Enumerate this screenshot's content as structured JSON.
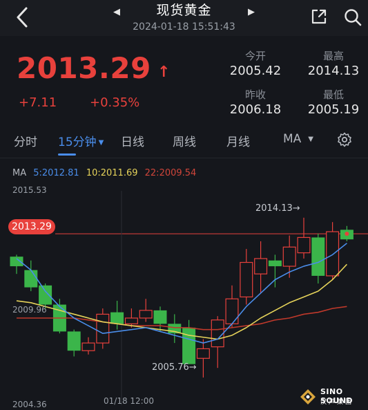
{
  "header": {
    "title": "现货黄金",
    "timestamp": "2024-01-18 15:51:43"
  },
  "quote": {
    "last": "2013.29",
    "change": "+7.11",
    "change_pct": "+0.35%",
    "stats": [
      {
        "label": "今开",
        "value": "2005.42"
      },
      {
        "label": "最高",
        "value": "2014.13"
      },
      {
        "label": "昨收",
        "value": "2006.18"
      },
      {
        "label": "最低",
        "value": "2005.19"
      }
    ]
  },
  "tabs": [
    {
      "label": "分时"
    },
    {
      "label": "15分钟"
    },
    {
      "label": "日线"
    },
    {
      "label": "周线"
    },
    {
      "label": "月线"
    },
    {
      "label": "MA"
    }
  ],
  "ma_legend": {
    "title": "MA",
    "ma5": "5:2012.81",
    "ma10": "10:2011.69",
    "ma22": "22:2009.54"
  },
  "colors": {
    "up": "#e8413c",
    "down": "#3bb54a",
    "ma5": "#4a8dea",
    "ma10": "#e6d35a",
    "ma22": "#c0392b"
  },
  "chart_data": {
    "type": "candlestick",
    "y_labels": [
      "2015.53",
      "2009.96",
      "2004.36"
    ],
    "ylim": [
      2004.36,
      2015.53
    ],
    "x_label": "01/18 12:00",
    "current_price_tag": "2013.29",
    "annotations": [
      {
        "text": "2014.13→",
        "value": 2014.13
      },
      {
        "text": "2005.76→",
        "value": 2005.76
      }
    ],
    "candles": [
      {
        "o": 2012.1,
        "c": 2011.6,
        "h": 2012.2,
        "l": 2011.2
      },
      {
        "o": 2011.4,
        "c": 2010.5,
        "h": 2011.9,
        "l": 2010.3
      },
      {
        "o": 2010.6,
        "c": 2009.6,
        "h": 2010.7,
        "l": 2009.4
      },
      {
        "o": 2009.6,
        "c": 2008.2,
        "h": 2009.9,
        "l": 2008.1
      },
      {
        "o": 2008.2,
        "c": 2007.2,
        "h": 2008.3,
        "l": 2006.9
      },
      {
        "o": 2007.2,
        "c": 2007.6,
        "h": 2007.9,
        "l": 2007.0
      },
      {
        "o": 2007.6,
        "c": 2009.1,
        "h": 2009.4,
        "l": 2007.3
      },
      {
        "o": 2009.2,
        "c": 2008.6,
        "h": 2009.8,
        "l": 2008.3
      },
      {
        "o": 2008.6,
        "c": 2008.9,
        "h": 2009.4,
        "l": 2008.4
      },
      {
        "o": 2008.9,
        "c": 2009.3,
        "h": 2009.9,
        "l": 2008.7
      },
      {
        "o": 2009.3,
        "c": 2008.6,
        "h": 2009.5,
        "l": 2008.2
      },
      {
        "o": 2008.6,
        "c": 2008.1,
        "h": 2009.1,
        "l": 2007.6
      },
      {
        "o": 2008.4,
        "c": 2006.5,
        "h": 2008.8,
        "l": 2006.5
      },
      {
        "o": 2006.8,
        "c": 2007.3,
        "h": 2007.8,
        "l": 2005.8
      },
      {
        "o": 2007.4,
        "c": 2008.8,
        "h": 2009.0,
        "l": 2006.3
      },
      {
        "o": 2008.6,
        "c": 2009.9,
        "h": 2010.6,
        "l": 2008.4
      },
      {
        "o": 2010.0,
        "c": 2011.8,
        "h": 2012.5,
        "l": 2009.6
      },
      {
        "o": 2011.2,
        "c": 2012.0,
        "h": 2012.9,
        "l": 2010.2
      },
      {
        "o": 2011.9,
        "c": 2011.6,
        "h": 2012.2,
        "l": 2010.5
      },
      {
        "o": 2011.6,
        "c": 2012.6,
        "h": 2013.2,
        "l": 2011.0
      },
      {
        "o": 2012.3,
        "c": 2013.1,
        "h": 2014.13,
        "l": 2012.0
      },
      {
        "o": 2013.1,
        "c": 2011.1,
        "h": 2013.3,
        "l": 2010.7
      },
      {
        "o": 2011.1,
        "c": 2013.4,
        "h": 2013.9,
        "l": 2010.9
      },
      {
        "o": 2013.5,
        "c": 2013.0,
        "h": 2013.7,
        "l": 2012.9
      }
    ],
    "ma5": [
      2012.0,
      2011.4,
      2010.3,
      2009.5,
      2008.9,
      2008.5,
      2008.1,
      2008.2,
      2008.3,
      2008.4,
      2008.2,
      2008.0,
      2007.8,
      2007.6,
      2007.8,
      2008.6,
      2009.5,
      2010.2,
      2010.9,
      2011.3,
      2011.6,
      2011.8,
      2012.2,
      2012.8
    ],
    "ma10": [
      2009.8,
      2009.7,
      2009.5,
      2009.3,
      2009.1,
      2008.9,
      2008.7,
      2008.6,
      2008.5,
      2008.4,
      2008.3,
      2008.2,
      2008.0,
      2007.9,
      2007.8,
      2008.0,
      2008.4,
      2008.9,
      2009.3,
      2009.7,
      2010.0,
      2010.3,
      2010.9,
      2011.7
    ],
    "ma22": [
      2008.9,
      2008.9,
      2008.9,
      2008.9,
      2008.9,
      2008.8,
      2008.7,
      2008.6,
      2008.5,
      2008.5,
      2008.5,
      2008.4,
      2008.4,
      2008.3,
      2008.3,
      2008.4,
      2008.5,
      2008.6,
      2008.8,
      2008.9,
      2009.1,
      2009.2,
      2009.4,
      2009.5
    ]
  },
  "brand": {
    "name": "SINO SOUND",
    "sub": "汉声集团"
  }
}
